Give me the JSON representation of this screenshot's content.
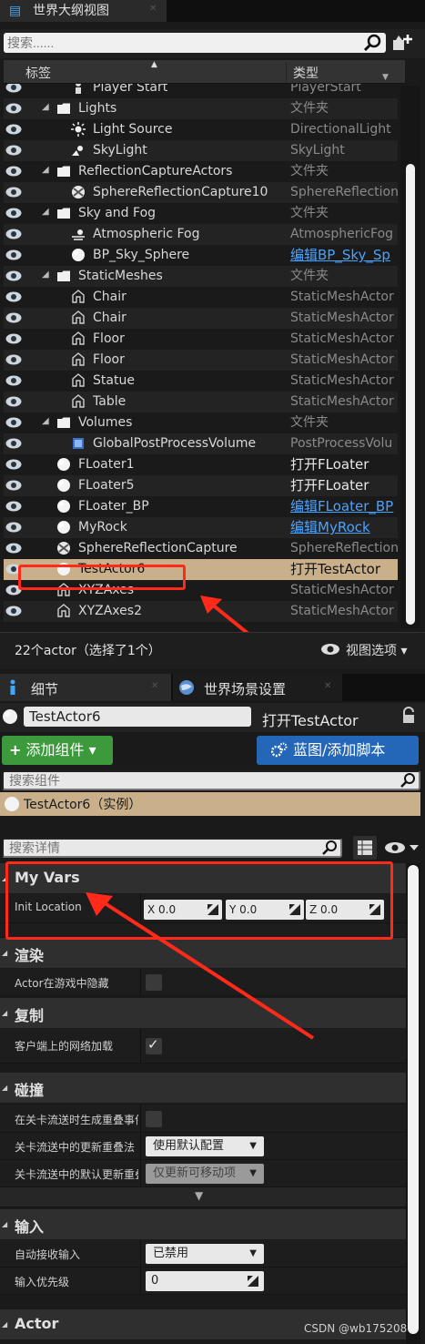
{
  "outliner": {
    "tab_title": "世界大纲视图",
    "search_placeholder": "搜索......",
    "col_label": "标签",
    "col_type": "类型",
    "rows": [
      {
        "name": "Player Start",
        "type": "PlayerStart",
        "indent": 2,
        "icon": "player-start-icon",
        "type_style": "normal"
      },
      {
        "name": "Lights",
        "type": "文件夹",
        "indent": 1,
        "icon": "folder-icon",
        "type_style": "normal",
        "expanded": true
      },
      {
        "name": "Light Source",
        "type": "DirectionalLight",
        "indent": 2,
        "icon": "sun-icon",
        "type_style": "normal"
      },
      {
        "name": "SkyLight",
        "type": "SkyLight",
        "indent": 2,
        "icon": "skylight-icon",
        "type_style": "normal"
      },
      {
        "name": "ReflectionCaptureActors",
        "type": "文件夹",
        "indent": 1,
        "icon": "folder-icon",
        "type_style": "normal",
        "expanded": true
      },
      {
        "name": "SphereReflectionCapture10",
        "type": "SphereReflection",
        "indent": 2,
        "icon": "reflection-icon",
        "type_style": "normal"
      },
      {
        "name": "Sky and Fog",
        "type": "文件夹",
        "indent": 1,
        "icon": "folder-icon",
        "type_style": "normal",
        "expanded": true
      },
      {
        "name": "Atmospheric Fog",
        "type": "AtmosphericFog",
        "indent": 2,
        "icon": "fog-icon",
        "type_style": "normal"
      },
      {
        "name": "BP_Sky_Sphere",
        "type": "编辑BP_Sky_Sp",
        "indent": 2,
        "icon": "sphere-icon",
        "type_style": "edit"
      },
      {
        "name": "StaticMeshes",
        "type": "文件夹",
        "indent": 1,
        "icon": "folder-icon",
        "type_style": "normal",
        "expanded": true
      },
      {
        "name": "Chair",
        "type": "StaticMeshActor",
        "indent": 2,
        "icon": "mesh-icon",
        "type_style": "normal"
      },
      {
        "name": "Chair",
        "type": "StaticMeshActor",
        "indent": 2,
        "icon": "mesh-icon",
        "type_style": "normal"
      },
      {
        "name": "Floor",
        "type": "StaticMeshActor",
        "indent": 2,
        "icon": "mesh-icon",
        "type_style": "normal"
      },
      {
        "name": "Floor",
        "type": "StaticMeshActor",
        "indent": 2,
        "icon": "mesh-icon",
        "type_style": "normal"
      },
      {
        "name": "Statue",
        "type": "StaticMeshActor",
        "indent": 2,
        "icon": "mesh-icon",
        "type_style": "normal"
      },
      {
        "name": "Table",
        "type": "StaticMeshActor",
        "indent": 2,
        "icon": "mesh-icon",
        "type_style": "normal"
      },
      {
        "name": "Volumes",
        "type": "文件夹",
        "indent": 1,
        "icon": "folder-icon",
        "type_style": "normal",
        "expanded": true
      },
      {
        "name": "GlobalPostProcessVolume",
        "type": "PostProcessVolu",
        "indent": 2,
        "icon": "volume-icon",
        "type_style": "normal"
      },
      {
        "name": "FLoater1",
        "type": "打开FLoater",
        "indent": 1,
        "icon": "sphere-icon",
        "type_style": "open"
      },
      {
        "name": "FLoater5",
        "type": "打开FLoater",
        "indent": 1,
        "icon": "sphere-icon",
        "type_style": "open"
      },
      {
        "name": "FLoater_BP",
        "type": "编辑FLoater_BP",
        "indent": 1,
        "icon": "sphere-icon",
        "type_style": "edit"
      },
      {
        "name": "MyRock",
        "type": "编辑MyRock",
        "indent": 1,
        "icon": "sphere-icon",
        "type_style": "edit"
      },
      {
        "name": "SphereReflectionCapture",
        "type": "SphereReflection",
        "indent": 1,
        "icon": "reflection-icon",
        "type_style": "normal"
      },
      {
        "name": "TestActor6",
        "type": "打开TestActor",
        "indent": 1,
        "icon": "sphere-icon",
        "type_style": "open",
        "selected": true
      },
      {
        "name": "XYZAxes",
        "type": "StaticMeshActor",
        "indent": 1,
        "icon": "mesh-icon",
        "type_style": "normal"
      },
      {
        "name": "XYZAxes2",
        "type": "StaticMeshActor",
        "indent": 1,
        "icon": "mesh-icon",
        "type_style": "normal"
      }
    ],
    "status": "22个actor（选择了1个）",
    "view_options": "视图选项"
  },
  "details": {
    "tab_details": "细节",
    "tab_world": "世界场景设置",
    "actor_name": "TestActor6",
    "open_link": "打开TestActor",
    "add_component": "添加组件",
    "blueprint_button": "蓝图/添加脚本",
    "component_search_placeholder": "搜索组件",
    "component_instance": "TestActor6（实例）",
    "details_search_placeholder": "搜索详情",
    "categories": {
      "myvars": "My Vars",
      "render": "渲染",
      "replication": "复制",
      "collision": "碰撞",
      "input": "输入",
      "actor": "Actor"
    },
    "props": {
      "init_location": "Init Location",
      "x": "X  0.0",
      "y": "Y  0.0",
      "z": "Z  0.0",
      "hidden_in_game": "Actor在游戏中隐藏",
      "net_load": "客户端上的网络加载",
      "gen_overlap": "在关卡流送时生成重叠事件",
      "update_overlap": "关卡流送中的更新重叠法",
      "update_overlap_value": "使用默认配置",
      "default_update": "关卡流送中的默认更新重叠",
      "default_update_value": "仅更新可移动项",
      "auto_input": "自动接收输入",
      "auto_input_value": "已禁用",
      "input_priority": "输入优先级",
      "input_priority_value": "0"
    }
  },
  "watermark": "CSDN @wb175208"
}
